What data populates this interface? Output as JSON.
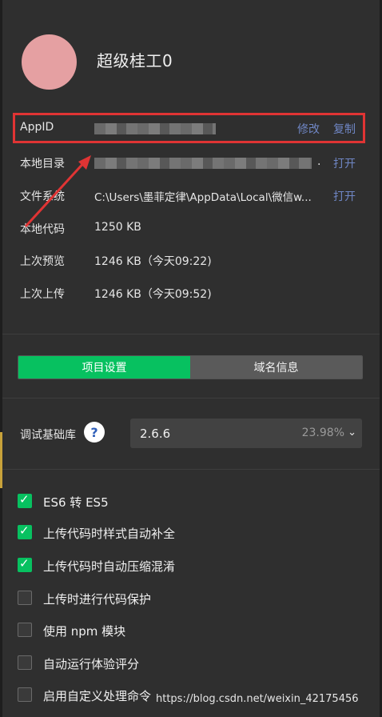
{
  "profile": {
    "username": "超级桂工0"
  },
  "info_rows": [
    {
      "label": "AppID",
      "value": "",
      "action1": "修改",
      "action2": "复制"
    },
    {
      "label": "本地目录",
      "value": ".",
      "action": "打开"
    },
    {
      "label": "文件系统",
      "value": "C:\\Users\\墨菲定律\\AppData\\Local\\微信w...",
      "action": "打开"
    },
    {
      "label": "本地代码",
      "value": "1250 KB"
    },
    {
      "label": "上次预览",
      "value": "1246 KB（今天09:22)"
    },
    {
      "label": "上次上传",
      "value": "1246 KB（今天09:52)"
    }
  ],
  "tabs": [
    {
      "label": "项目设置",
      "active": true
    },
    {
      "label": "域名信息",
      "active": false
    }
  ],
  "debug_lib": {
    "label": "调试基础库",
    "help_icon": "help-icon",
    "help_glyph": "?",
    "selected_version": "2.6.6",
    "usage_percent": "23.98%",
    "chevron": "⌄"
  },
  "options": [
    {
      "label": "ES6 转 ES5",
      "checked": true
    },
    {
      "label": "上传代码时样式自动补全",
      "checked": true
    },
    {
      "label": "上传代码时自动压缩混淆",
      "checked": true
    },
    {
      "label": "上传时进行代码保护",
      "checked": false
    },
    {
      "label": "使用 npm 模块",
      "checked": false
    },
    {
      "label": "自动运行体验评分",
      "checked": false
    },
    {
      "label": "启用自定义处理命令",
      "checked": false
    }
  ],
  "watermark": "https://blog.csdn.net/weixin_42175456",
  "colors": {
    "accent_green": "#07c160",
    "link_blue": "#6f86c4",
    "annotation_red": "#e03434",
    "avatar_pink": "#e5a0a2"
  }
}
